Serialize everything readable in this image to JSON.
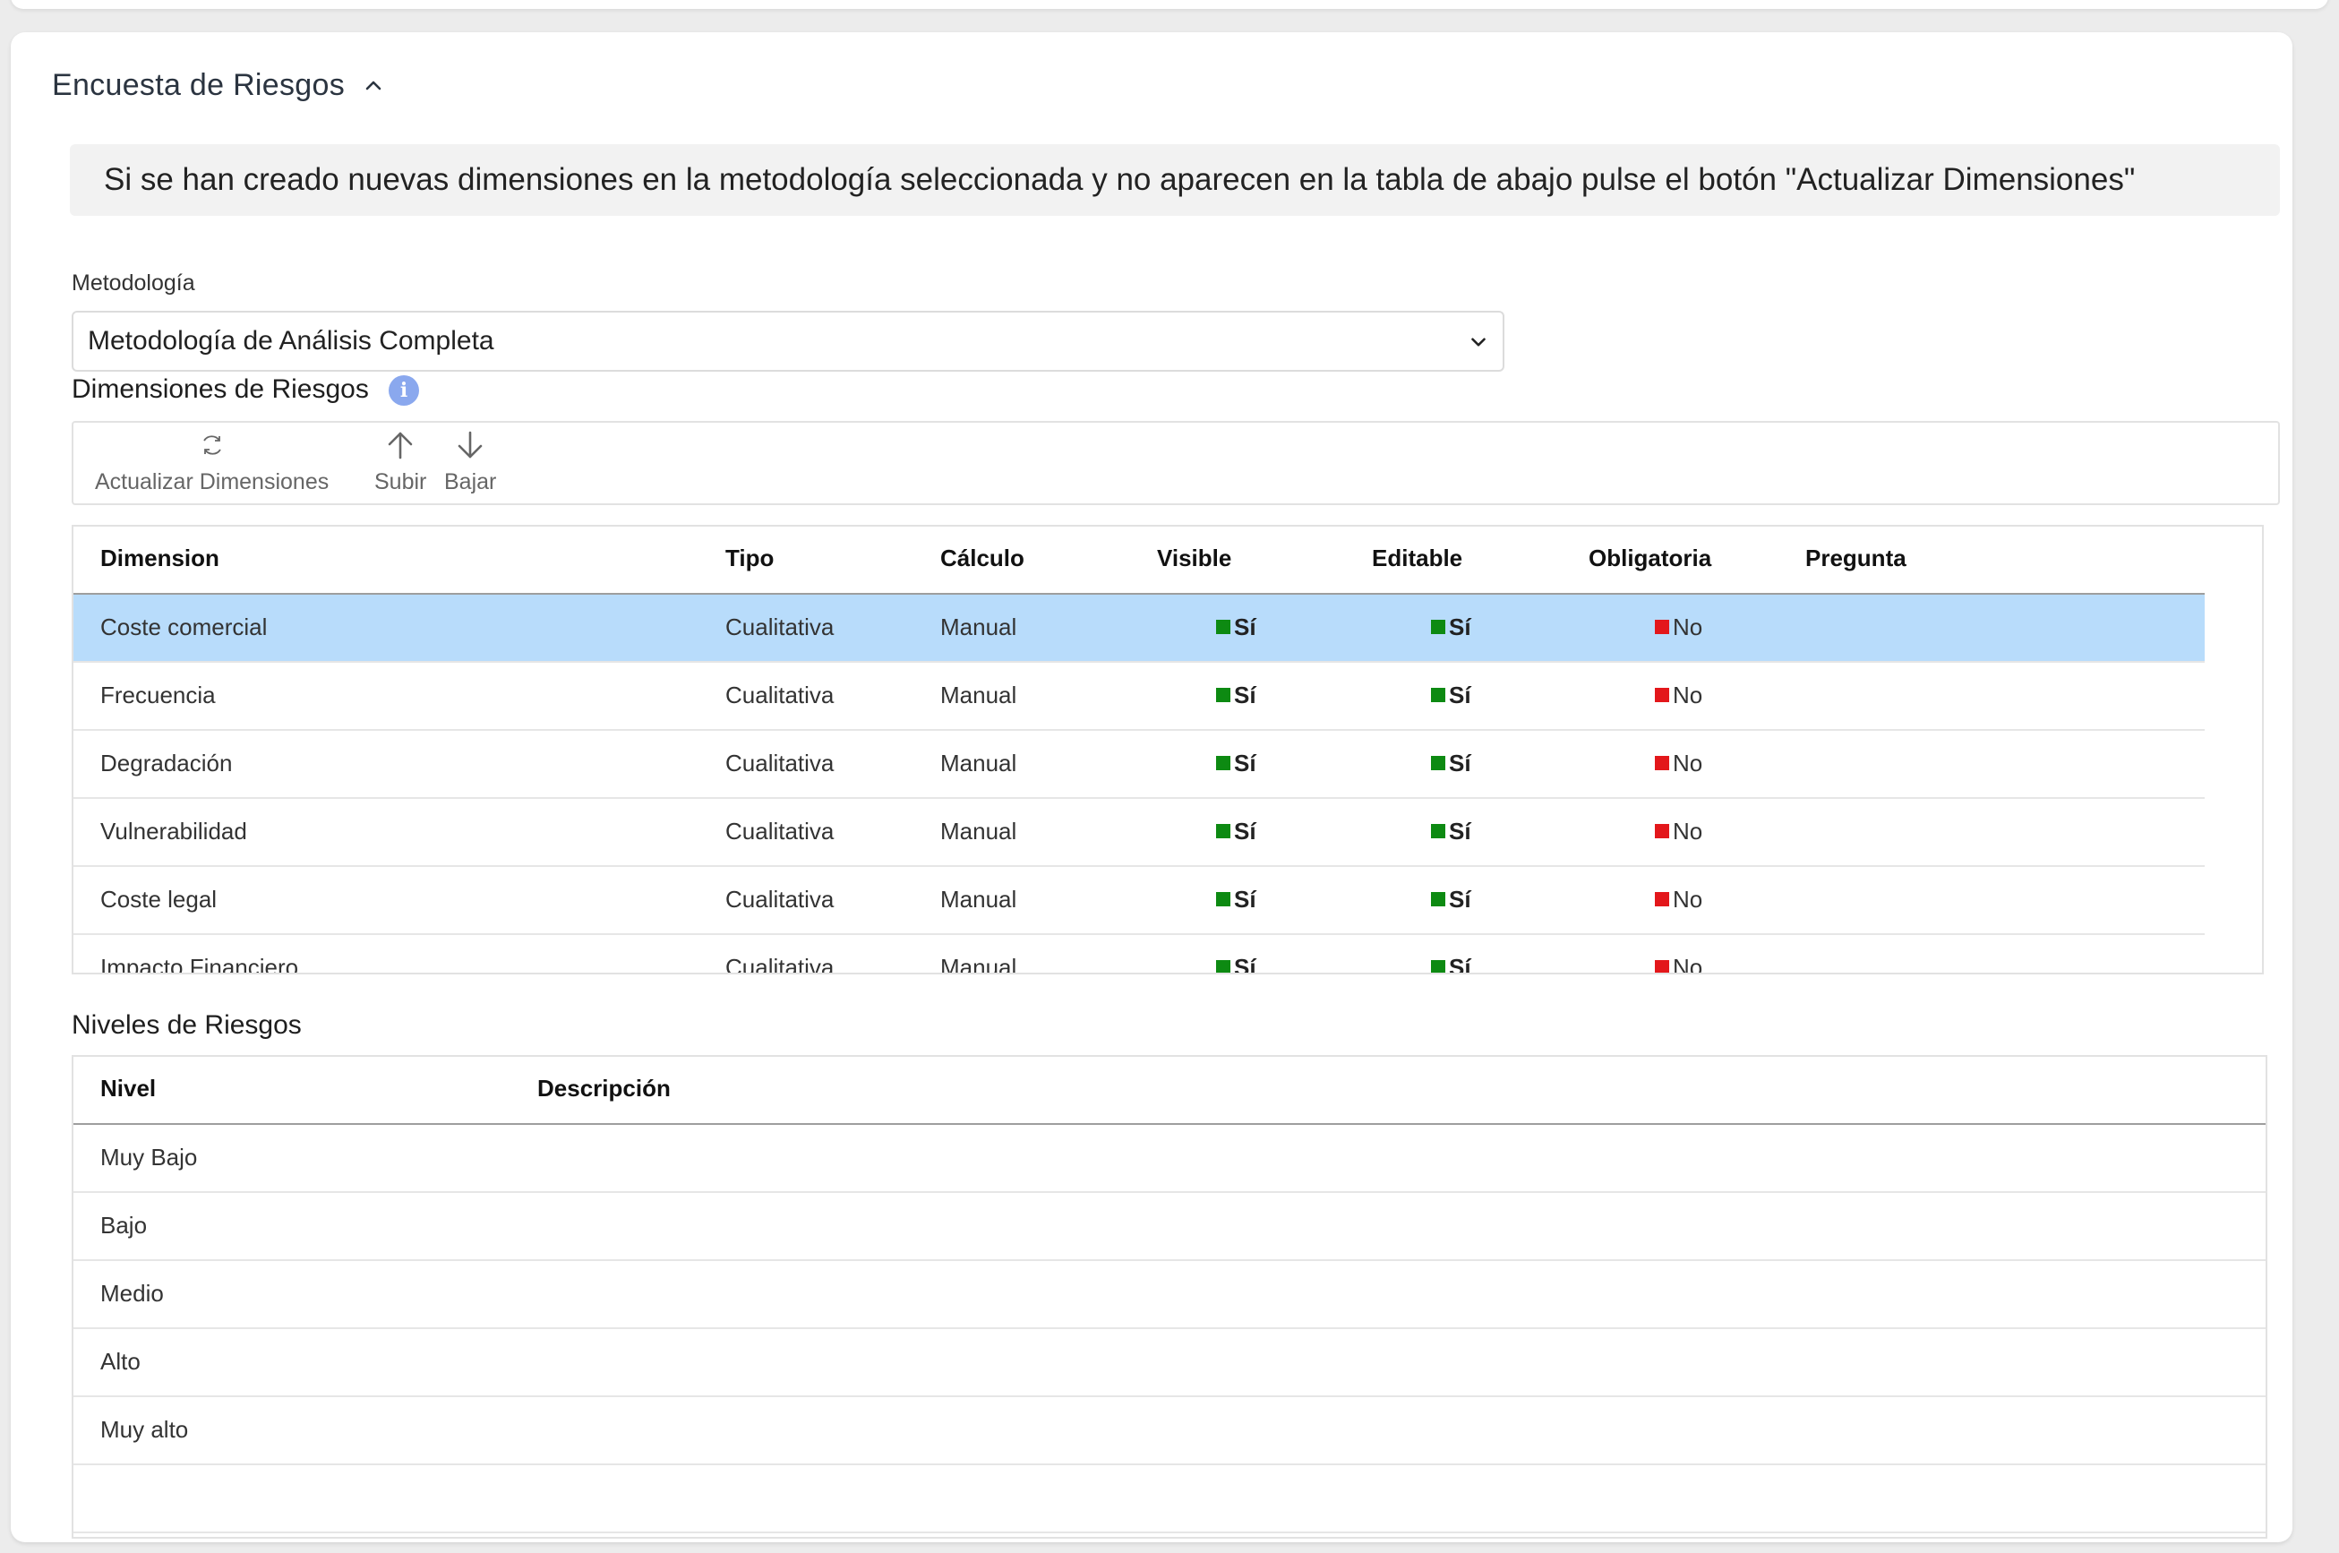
{
  "section": {
    "title": "Encuesta de Riesgos",
    "banner": "Si se han creado nuevas dimensiones en la metodología seleccionada y no aparecen en la tabla de abajo pulse el botón \"Actualizar Dimensiones\""
  },
  "metodologia": {
    "label": "Metodología",
    "value": "Metodología de Análisis Completa"
  },
  "dimensiones": {
    "title": "Dimensiones de Riesgos",
    "info_icon": "i",
    "toolbar": {
      "refresh_label": "Actualizar Dimensiones",
      "up_label": "Subir",
      "down_label": "Bajar"
    },
    "columns": [
      "Dimension",
      "Tipo",
      "Cálculo",
      "Visible",
      "Editable",
      "Obligatoria",
      "Pregunta"
    ],
    "rows": [
      {
        "dimension": "Coste comercial",
        "tipo": "Cualitativa",
        "calculo": "Manual",
        "visible": "Sí",
        "editable": "Sí",
        "obligatoria": "No",
        "pregunta": ""
      },
      {
        "dimension": "Frecuencia",
        "tipo": "Cualitativa",
        "calculo": "Manual",
        "visible": "Sí",
        "editable": "Sí",
        "obligatoria": "No",
        "pregunta": ""
      },
      {
        "dimension": "Degradación",
        "tipo": "Cualitativa",
        "calculo": "Manual",
        "visible": "Sí",
        "editable": "Sí",
        "obligatoria": "No",
        "pregunta": ""
      },
      {
        "dimension": "Vulnerabilidad",
        "tipo": "Cualitativa",
        "calculo": "Manual",
        "visible": "Sí",
        "editable": "Sí",
        "obligatoria": "No",
        "pregunta": ""
      },
      {
        "dimension": "Coste legal",
        "tipo": "Cualitativa",
        "calculo": "Manual",
        "visible": "Sí",
        "editable": "Sí",
        "obligatoria": "No",
        "pregunta": ""
      },
      {
        "dimension": "Impacto Financiero",
        "tipo": "Cualitativa",
        "calculo": "Manual",
        "visible": "Sí",
        "editable": "Sí",
        "obligatoria": "No",
        "pregunta": ""
      }
    ],
    "selected_row": 0
  },
  "niveles": {
    "title": "Niveles de Riesgos",
    "columns": [
      "Nivel",
      "Descripción"
    ],
    "rows": [
      {
        "nivel": "Muy Bajo",
        "descripcion": ""
      },
      {
        "nivel": "Bajo",
        "descripcion": ""
      },
      {
        "nivel": "Medio",
        "descripcion": ""
      },
      {
        "nivel": "Alto",
        "descripcion": ""
      },
      {
        "nivel": "Muy alto",
        "descripcion": ""
      },
      {
        "nivel": "",
        "descripcion": ""
      }
    ]
  },
  "colors": {
    "selected_row": "#b8dcfb",
    "yes_flag": "#0d8a12",
    "no_flag": "#e3171b",
    "info_icon": "#8aa8ee"
  }
}
